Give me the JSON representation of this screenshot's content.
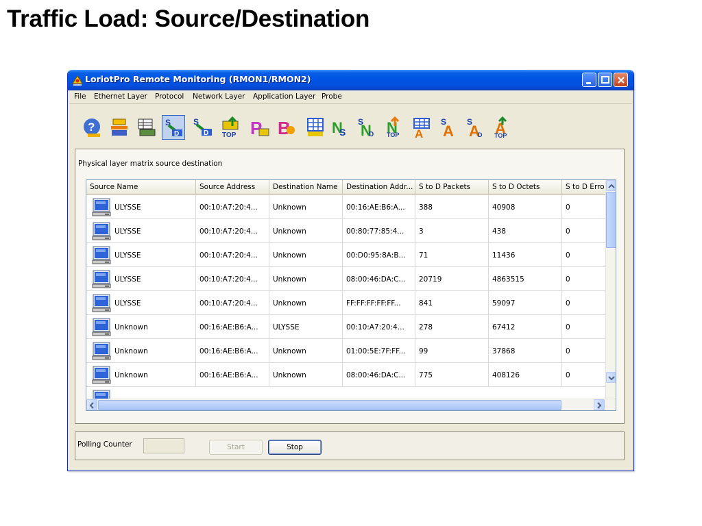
{
  "slide": {
    "title": "Traffic Load: Source/Destination"
  },
  "window": {
    "title": "LoriotPro Remote Monitoring (RMON1/RMON2)",
    "menu": [
      "File",
      "Ethernet Layer",
      "Protocol",
      "Network Layer",
      "Application Layer",
      "Probe"
    ]
  },
  "toolbar": {
    "icons": [
      "help-icon",
      "bus-stats-icon",
      "history-icon",
      "matrix-sd-icon",
      "matrix-sd-top-icon",
      "top-host-icon",
      "protocol-p-icon",
      "protocol-b-icon",
      "table-icon",
      "network-ns-icon",
      "network-sd-icon",
      "network-top-icon",
      "app-table-icon",
      "app-a-icon",
      "app-sd-icon",
      "app-top-icon"
    ],
    "active": "matrix-sd-icon"
  },
  "panel": {
    "label": "Physical layer matrix source destination"
  },
  "table": {
    "columns": [
      "Source Name",
      "Source Address",
      "Destination Name",
      "Destination Addr...",
      "S to D Packets",
      "S to D Octets",
      "S to D Erro"
    ],
    "rows": [
      [
        "ULYSSE",
        "00:10:A7:20:4...",
        "Unknown",
        "00:16:AE:B6:A...",
        "388",
        "40908",
        "0"
      ],
      [
        "ULYSSE",
        "00:10:A7:20:4...",
        "Unknown",
        "00:80:77:85:4...",
        "3",
        "438",
        "0"
      ],
      [
        "ULYSSE",
        "00:10:A7:20:4...",
        "Unknown",
        "00:D0:95:8A:B...",
        "71",
        "11436",
        "0"
      ],
      [
        "ULYSSE",
        "00:10:A7:20:4...",
        "Unknown",
        "08:00:46:DA:C...",
        "20719",
        "4863515",
        "0"
      ],
      [
        "ULYSSE",
        "00:10:A7:20:4...",
        "Unknown",
        "FF:FF:FF:FF:FF...",
        "841",
        "59097",
        "0"
      ],
      [
        "Unknown",
        "00:16:AE:B6:A...",
        "ULYSSE",
        "00:10:A7:20:4...",
        "278",
        "67412",
        "0"
      ],
      [
        "Unknown",
        "00:16:AE:B6:A...",
        "Unknown",
        "01:00:5E:7F:FF...",
        "99",
        "37868",
        "0"
      ],
      [
        "Unknown",
        "00:16:AE:B6:A...",
        "Unknown",
        "08:00:46:DA:C...",
        "775",
        "408126",
        "0"
      ]
    ]
  },
  "polling": {
    "label": "Polling Counter",
    "value": "",
    "start_label": "Start",
    "stop_label": "Stop"
  },
  "colors": {
    "titlebar": "#0055e5",
    "window_bg": "#ece9d8",
    "selection": "#316ac5"
  }
}
